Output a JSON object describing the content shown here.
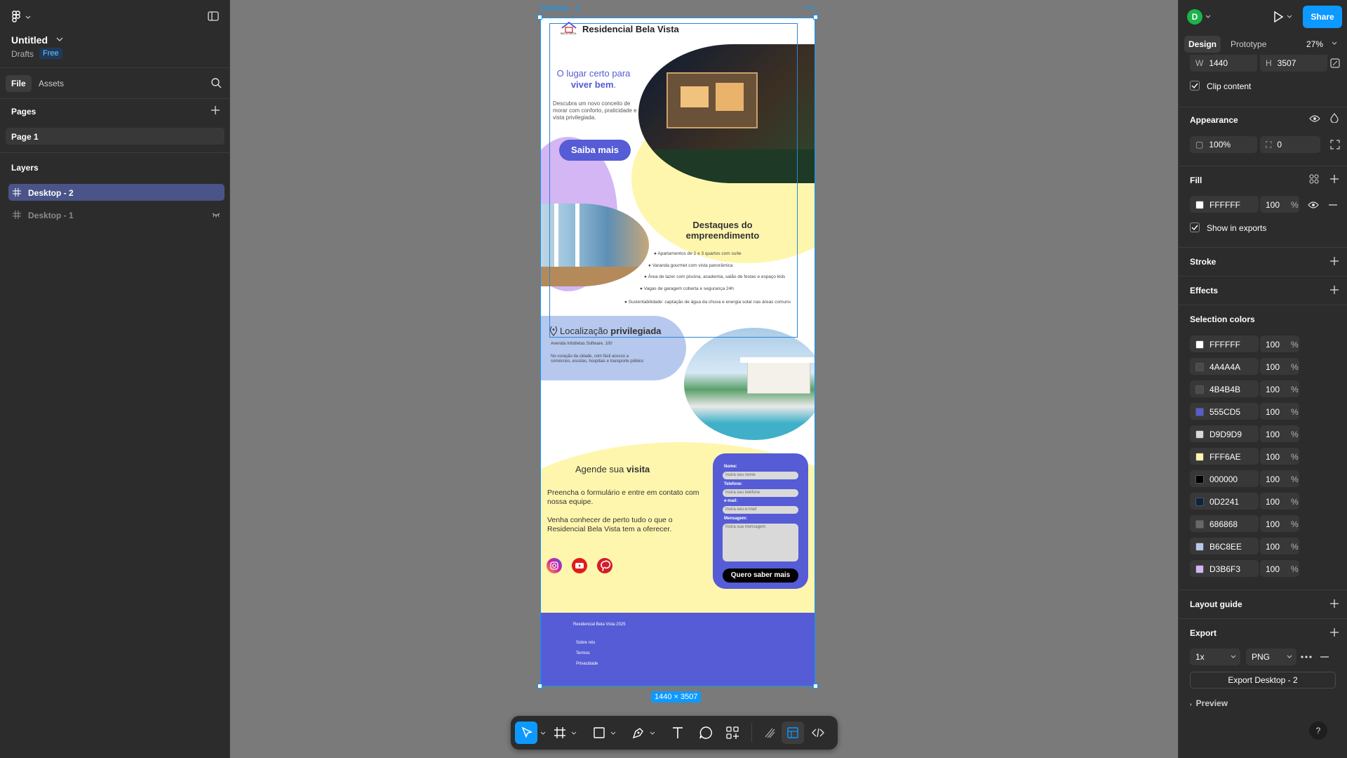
{
  "app": {
    "file_title": "Untitled",
    "drafts": "Drafts",
    "plan_badge": "Free"
  },
  "left": {
    "tabs": [
      "File",
      "Assets"
    ],
    "pages_title": "Pages",
    "pages": [
      "Page 1"
    ],
    "layers_title": "Layers",
    "layers": [
      "Desktop - 2",
      "Desktop - 1"
    ]
  },
  "canvas": {
    "frame_label": "Desktop - 2",
    "size_badge": "1440 × 3507"
  },
  "site": {
    "brand": "Residencial Bela Vista",
    "logo_text": "BELA VISTA",
    "hero_line1": "O lugar certo para",
    "hero_line2": "viver bem",
    "hero_dot": ".",
    "hero_desc": "Descubra um novo conceito de morar com conforto, praticidade e vista privilegiada.",
    "hero_button": "Saiba mais",
    "highlights_title": "Destaques do empreendimento",
    "highlights": [
      "Apartamentos de 2 e 3 quartos com suíte",
      "Varanda gourmet com vista panorâmica",
      "Área de lazer com piscina, academia, salão de festas e espaço kids",
      "Vagas de garagem coberta e segurança 24h",
      "Sustentabilidade: captação de água da chuva e energia solar nas áreas comuns"
    ],
    "location_title_a": "Localização ",
    "location_title_b": "privilegiada",
    "location_address": "Avenida Infotiletas Software, 100",
    "location_desc": "No coração da cidade, com fácil acesso a comércios, escolas, hospitais e transporte público",
    "visit_title_a": "Agende sua ",
    "visit_title_b": "visita",
    "visit_p1": "Preencha o formulário e entre em contato com nossa equipe.",
    "visit_p2": "Venha conhecer de perto tudo o que o Residencial Bela Vista tem a oferecer.",
    "form": {
      "name_label": "Nome:",
      "name_ph": "Insira seu nome",
      "phone_label": "Telefone:",
      "phone_ph": "Insira seu telefone",
      "email_label": "e-mail:",
      "email_ph": "Insira seu e-mail",
      "msg_label": "Mensagem:",
      "msg_ph": "Insira sua mensagem",
      "submit": "Quero saber mais"
    },
    "footer": {
      "copyright": "Residencial Bela Vista 2025",
      "links": [
        "Sobre nós",
        "Termos",
        "Privacidade"
      ]
    }
  },
  "right": {
    "avatar": "D",
    "share": "Share",
    "tabs": [
      "Design",
      "Prototype"
    ],
    "zoom": "27%",
    "w_label": "W",
    "w": "1440",
    "h_label": "H",
    "h": "3507",
    "clip": "Clip content",
    "appearance_title": "Appearance",
    "opacity": "100%",
    "radius": "0",
    "fill_title": "Fill",
    "fill_hex": "FFFFFF",
    "fill_pct": "100",
    "pct_sign": "%",
    "show_exports": "Show in exports",
    "stroke_title": "Stroke",
    "effects_title": "Effects",
    "selection_title": "Selection colors",
    "selection_colors": [
      {
        "hex": "FFFFFF",
        "pct": "100"
      },
      {
        "hex": "4A4A4A",
        "pct": "100"
      },
      {
        "hex": "4B4B4B",
        "pct": "100"
      },
      {
        "hex": "555CD5",
        "pct": "100"
      },
      {
        "hex": "D9D9D9",
        "pct": "100"
      },
      {
        "hex": "FFF6AE",
        "pct": "100"
      },
      {
        "hex": "000000",
        "pct": "100"
      },
      {
        "hex": "0D2241",
        "pct": "100"
      },
      {
        "hex": "686868",
        "pct": "100"
      },
      {
        "hex": "B6C8EE",
        "pct": "100"
      },
      {
        "hex": "D3B6F3",
        "pct": "100"
      }
    ],
    "layout_guide_title": "Layout guide",
    "export_title": "Export",
    "export_scale": "1x",
    "export_format": "PNG",
    "export_button": "Export Desktop - 2",
    "preview": "Preview"
  },
  "colors": {
    "accent": "#0d99ff",
    "brand": "#555CD5",
    "yellow": "#FFF6AE",
    "lavender": "#D3B6F3",
    "light_blue": "#B6C8EE"
  }
}
